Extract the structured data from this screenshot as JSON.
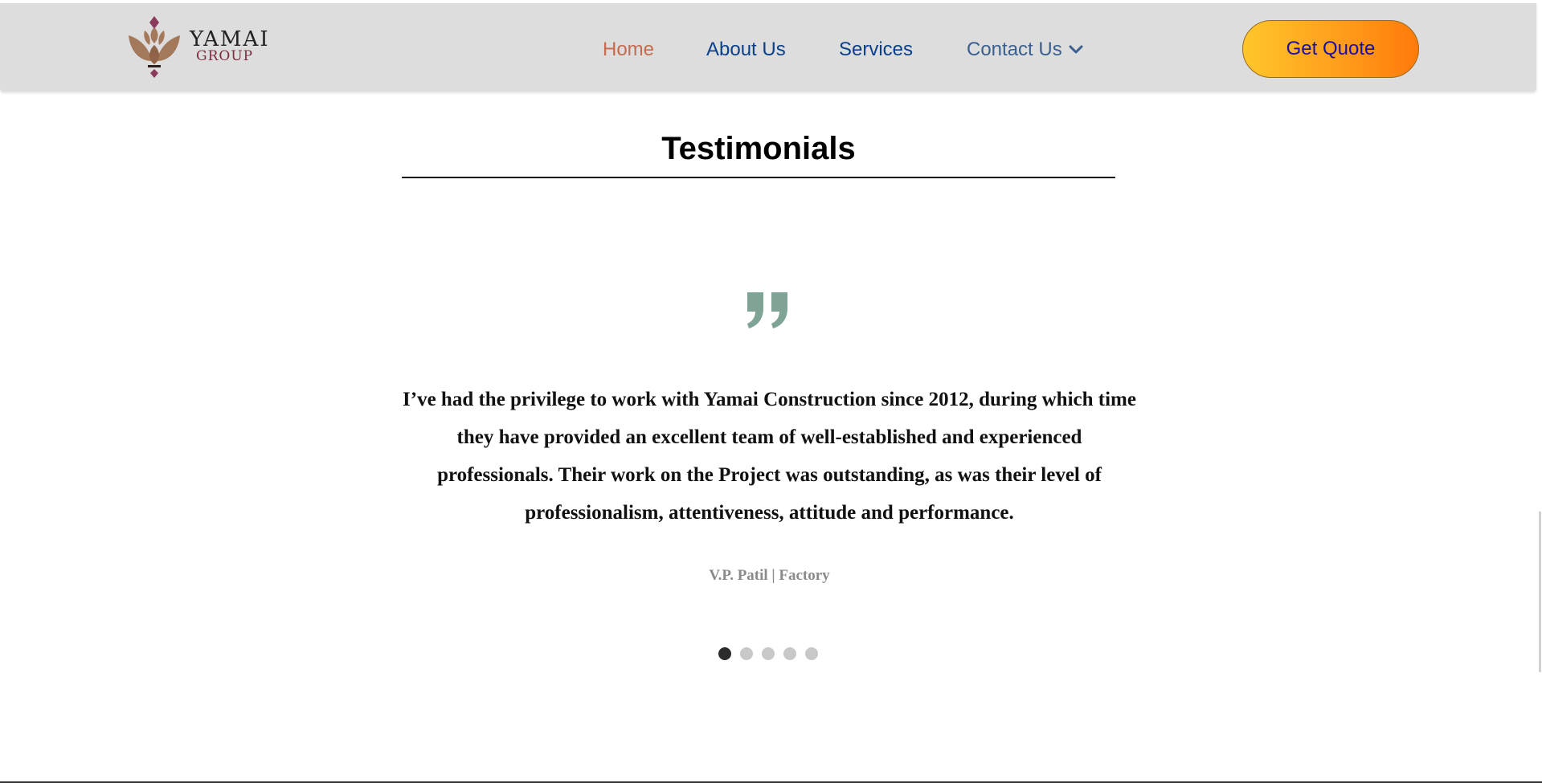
{
  "brand": {
    "name_line1": "YAMAI",
    "name_line2": "GROUP"
  },
  "nav": {
    "items": [
      {
        "label": "Home",
        "active": true
      },
      {
        "label": "About Us",
        "active": false
      },
      {
        "label": "Services",
        "active": false
      },
      {
        "label": "Contact Us",
        "active": false,
        "has_dropdown": true
      }
    ],
    "cta_label": "Get Quote"
  },
  "testimonials": {
    "title": "Testimonials",
    "quote_icon": "quote-icon",
    "text": "I’ve had the privilege to work with Yamai Construction since 2012, during which time they have provided an excellent team of well-established and experienced professionals. Their work on the Project was outstanding, as was their level of professionalism, attentiveness, attitude and performance.",
    "author": "V.P. Patil | Factory",
    "slide_count": 5,
    "active_slide": 1
  },
  "colors": {
    "header_bg": "#dddddd",
    "nav_active": "#c66b4d",
    "nav_link": "#0a3f8c",
    "cta_gradient_start": "#ffc62b",
    "cta_gradient_end": "#ff7a0a",
    "quote_icon": "#7fa394",
    "dot_active": "#2b2b2b",
    "dot_inactive": "#c8c8c8"
  }
}
